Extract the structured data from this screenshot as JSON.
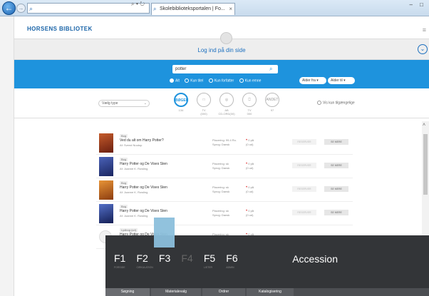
{
  "browser": {
    "address_text": "",
    "address_tools": "⌕ ▾ ↻",
    "tab_title": "Skolebiblioteksportalen | Fo...",
    "tab_close": "×",
    "win_controls": "– □",
    "win_controls2": "⌂"
  },
  "site": {
    "logo": "HORSENS BIBLIOTEK",
    "menu_icon": "≡",
    "login": "Log ind på din side"
  },
  "search": {
    "query": "potter",
    "options": [
      "Alt",
      "Kun titel",
      "Kun forfatter",
      "Kun emne"
    ],
    "sort_a": "Alder fra",
    "sort_b": "Alder til"
  },
  "filters": {
    "type_select": "Vælg type",
    "categories": [
      {
        "icon": "BØGER",
        "sub": "134",
        "active": true
      },
      {
        "icon": "□",
        "sub": "TV\n(000)"
      },
      {
        "icon": "◎",
        "sub": "AB\nCD-ORD(00)"
      },
      {
        "icon": "⎕",
        "sub": "TV\n000"
      },
      {
        "icon": "ANDET",
        "sub": "97"
      }
    ],
    "available_only": "Vis kun tilgængelige"
  },
  "results": [
    {
      "badge": "Bog",
      "title": "Ved du alt om Harry Potter?",
      "author": "Af: Svend Nuutup",
      "shelf1": "Placering: 99.4 Ro.",
      "shelf2": "Sprog: Dansk",
      "avail1": "0 på",
      "avail2": "(0 ud)",
      "reserve": "RESERVER",
      "more": "SE MERE",
      "cover": "#9a3b22"
    },
    {
      "badge": "Bog",
      "title": "Harry Potter og De Vises Sten",
      "author": "Af: Joanne K. Rowling",
      "shelf1": "Placering: sk",
      "shelf2": "Sprog: Dansk",
      "avail1": "0 på",
      "avail2": "(0 ud)",
      "reserve": "RESERVER",
      "more": "SE MERE",
      "cover": "#2b3f8a"
    },
    {
      "badge": "Bog",
      "title": "Harry Potter og De Vises Sten",
      "author": "Af: Joanne K. Rowling",
      "shelf1": "Placering: sk",
      "shelf2": "Sprog: Dansk",
      "avail1": "0 på",
      "avail2": "(0 ud)",
      "reserve": "RESERVER",
      "more": "SE MERE",
      "cover": "#c2641d"
    },
    {
      "badge": "Bog",
      "title": "Harry Potter og De Vises Sten",
      "author": "Af: Joanne K. Rowling",
      "shelf1": "Placering: sk",
      "shelf2": "Sprog: Dansk",
      "avail1": "0 på",
      "avail2": "(0 ud)",
      "reserve": "RESERVER",
      "more": "SE MERE",
      "cover": "#32458c"
    },
    {
      "badge": "Lydbog (cd)",
      "title": "Harry Potter og De Vises Sten",
      "author": "",
      "shelf1": "Placering: sk",
      "shelf2": "",
      "avail1": "0 på",
      "avail2": "",
      "reserve": "RESERVER",
      "more": "SE MERE",
      "cover": ""
    }
  ],
  "accession": {
    "keys": [
      {
        "key": "F1",
        "sub": "FORSIDE",
        "state": "normal"
      },
      {
        "key": "F2",
        "sub": "CIRKULATION",
        "state": "normal"
      },
      {
        "key": "F3",
        "sub": "",
        "state": "selected"
      },
      {
        "key": "F4",
        "sub": "",
        "state": "dim"
      },
      {
        "key": "F5",
        "sub": "LISTER",
        "state": "normal"
      },
      {
        "key": "F6",
        "sub": "ADMIN",
        "state": "normal"
      }
    ],
    "title": "Accession",
    "tabs": [
      "Søgning",
      "Materialevalg",
      "Ordrer",
      "Katalogisering"
    ]
  }
}
